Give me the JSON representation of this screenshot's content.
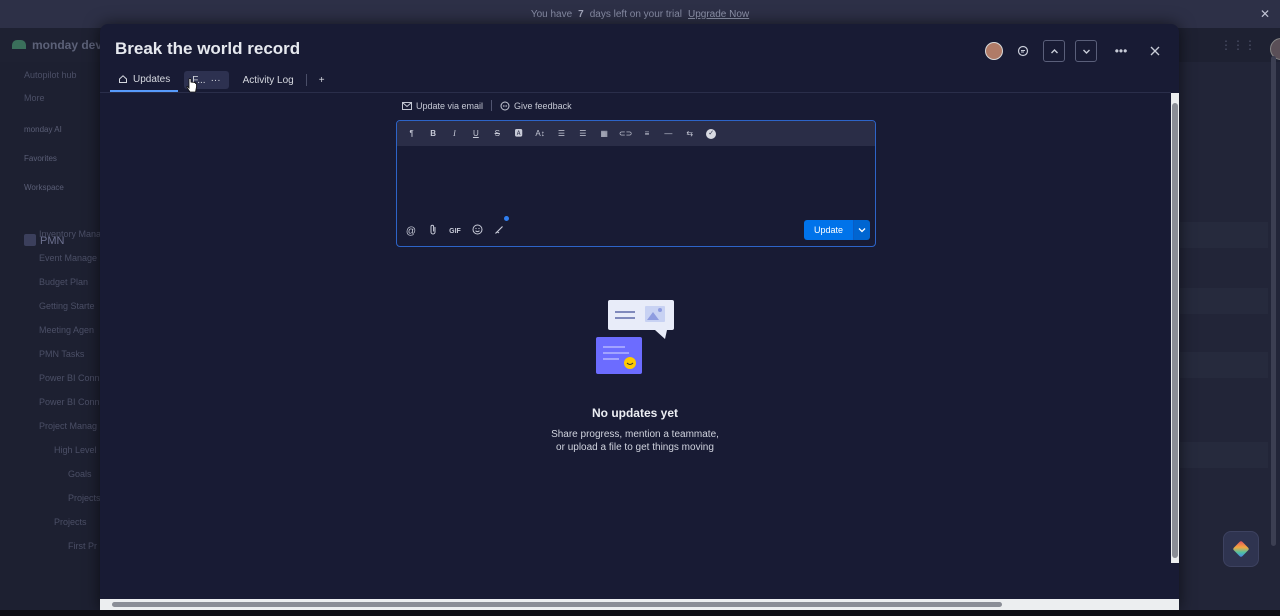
{
  "trial_bar": {
    "text_before": "You have",
    "days": "7",
    "text_after": "days left on your trial",
    "upgrade_label": "Upgrade Now"
  },
  "background_app": {
    "logo": "monday dev",
    "sidebar": [
      "Autopilot hub",
      "More",
      "monday AI",
      "Favorites",
      "Workspace",
      "PMN",
      "Inventory Mana",
      "Event Manage",
      "Budget Plan",
      "Getting Starte",
      "Meeting Agen",
      "PMN Tasks",
      "Power BI Conn",
      "Power BI Conn",
      "Project Manag",
      "High Level",
      "Goals",
      "Projects",
      "Projects",
      "First Pr"
    ]
  },
  "panel": {
    "title": "Break the world record",
    "tabs": {
      "updates": "Updates",
      "files": "F...",
      "more": "···",
      "activity_log": "Activity Log",
      "add": "+"
    },
    "links": {
      "update_via_email": "Update via email",
      "give_feedback": "Give feedback"
    },
    "editor": {
      "toolbar_icons": [
        "paragraph-icon",
        "bold-icon",
        "italic-icon",
        "underline-icon",
        "strikethrough-icon",
        "text-color-icon",
        "font-size-icon",
        "numbered-list-icon",
        "bullet-list-icon",
        "table-icon",
        "link-icon",
        "align-icon",
        "divider-icon",
        "direction-icon",
        "checklist-icon"
      ],
      "footer_icons": [
        "mention-icon",
        "attach-icon",
        "gif-icon",
        "emoji-icon",
        "ai-write-icon"
      ],
      "gif_label": "GIF",
      "update_button": "Update"
    },
    "empty_state": {
      "title": "No updates yet",
      "line1": "Share progress, mention a teammate,",
      "line2": "or upload a file to get things moving"
    }
  }
}
